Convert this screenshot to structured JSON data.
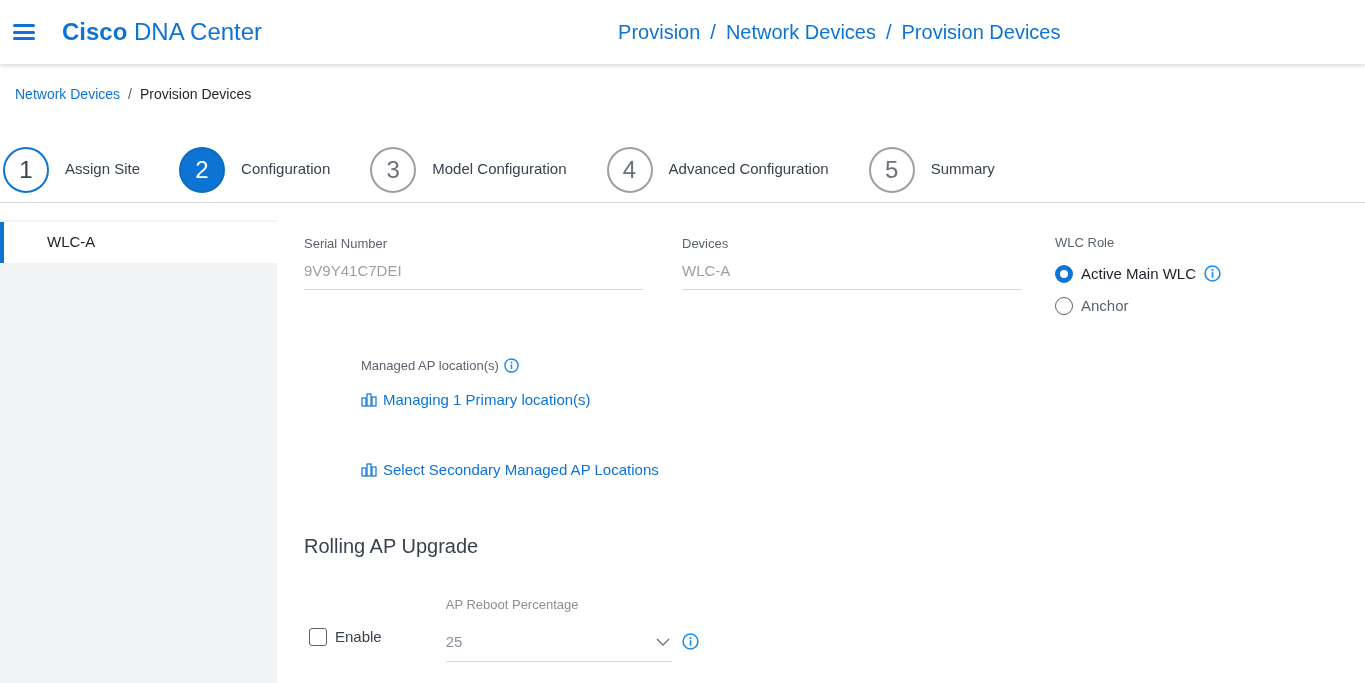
{
  "header": {
    "brand_bold": "Cisco",
    "brand_rest": "DNA Center",
    "path": [
      "Provision",
      "Network Devices",
      "Provision Devices"
    ],
    "path_separator": "/"
  },
  "breadcrumb": {
    "items": [
      {
        "label": "Network Devices",
        "link": true
      },
      {
        "label": "Provision Devices",
        "link": false
      }
    ],
    "separator": "/"
  },
  "steps": [
    {
      "number": "1",
      "label": "Assign Site",
      "selected": false,
      "completed": true
    },
    {
      "number": "2",
      "label": "Configuration",
      "selected": true,
      "completed": false
    },
    {
      "number": "3",
      "label": "Model Configuration",
      "selected": false,
      "completed": false
    },
    {
      "number": "4",
      "label": "Advanced Configuration",
      "selected": false,
      "completed": false
    },
    {
      "number": "5",
      "label": "Summary",
      "selected": false,
      "completed": false
    }
  ],
  "sidebar": {
    "items": [
      {
        "label": "WLC-A",
        "selected": true
      }
    ]
  },
  "fields": [
    {
      "label": "Serial Number",
      "value": "9V9Y41C7DEI"
    },
    {
      "label": "Devices",
      "value": "WLC-A"
    }
  ],
  "wlc_role": {
    "label": "WLC Role",
    "options": [
      {
        "label": "Active Main WLC",
        "selected": true,
        "info": true
      },
      {
        "label": "Anchor",
        "selected": false,
        "info": false
      }
    ]
  },
  "managed_ap": {
    "label": "Managed AP location(s)",
    "links": [
      "Managing 1 Primary location(s)",
      "Select Secondary Managed AP Locations"
    ]
  },
  "rolling_upgrade": {
    "title": "Rolling AP Upgrade",
    "enable": {
      "label": "Enable",
      "checked": false
    },
    "percentage": {
      "label": "AP Reboot Percentage",
      "value": "25"
    }
  }
}
